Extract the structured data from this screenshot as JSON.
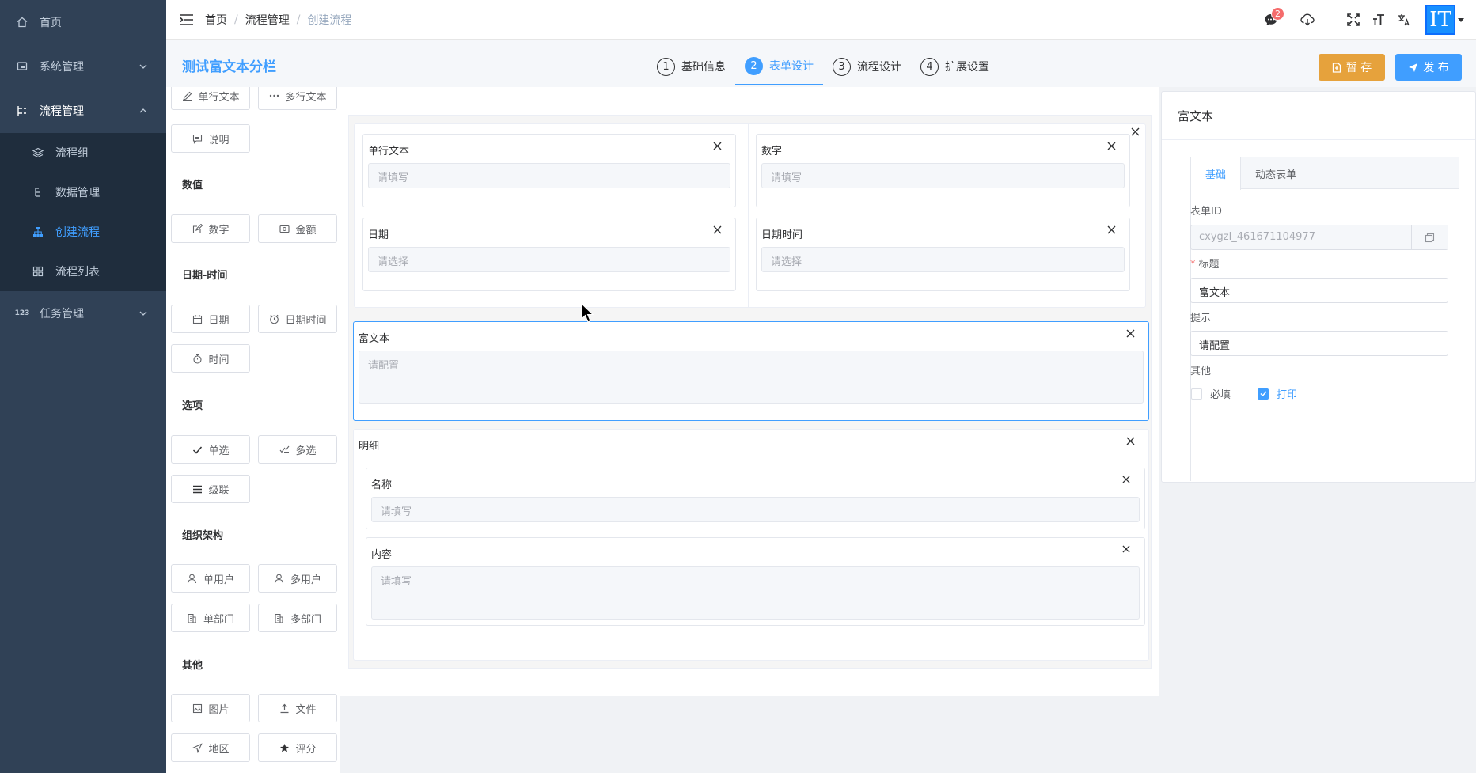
{
  "sidebar": {
    "items": [
      {
        "label": "首页",
        "icon": "home-icon"
      },
      {
        "label": "系统管理",
        "icon": "monitor-icon"
      },
      {
        "label": "流程管理",
        "icon": "tree-icon"
      },
      {
        "label": "任务管理",
        "icon": "number-icon"
      }
    ],
    "flow_children": [
      {
        "label": "流程组",
        "icon": "layers-icon"
      },
      {
        "label": "数据管理",
        "icon": "tree-small-icon"
      },
      {
        "label": "创建流程",
        "icon": "org-chart-icon",
        "active": true
      },
      {
        "label": "流程列表",
        "icon": "grid-icon"
      }
    ]
  },
  "navbar": {
    "breadcrumb": [
      "首页",
      "流程管理",
      "创建流程"
    ],
    "badge_count": "2",
    "avatar_text": "IT"
  },
  "header": {
    "form_title": "测试富文本分栏",
    "steps": [
      {
        "num": "1",
        "label": "基础信息"
      },
      {
        "num": "2",
        "label": "表单设计"
      },
      {
        "num": "3",
        "label": "流程设计"
      },
      {
        "num": "4",
        "label": "扩展设置"
      }
    ],
    "save_label": "暂 存",
    "publish_label": "发 布"
  },
  "palette": {
    "categories": [
      "数值",
      "日期-时间",
      "选项",
      "组织架构",
      "其他"
    ],
    "buttons": {
      "single_text": "单行文本",
      "multi_text": "多行文本",
      "description": "说明",
      "number": "数字",
      "amount": "金额",
      "date": "日期",
      "datetime": "日期时间",
      "time": "时间",
      "radio": "单选",
      "checkbox": "多选",
      "cascade": "级联",
      "single_user": "单用户",
      "multi_user": "多用户",
      "single_dept": "单部门",
      "multi_dept": "多部门",
      "image": "图片",
      "file": "文件",
      "region": "地区",
      "rating": "评分"
    }
  },
  "canvas": {
    "fields": {
      "single_text": {
        "label": "单行文本",
        "placeholder": "请填写"
      },
      "number": {
        "label": "数字",
        "placeholder": "请填写"
      },
      "date": {
        "label": "日期",
        "placeholder": "请选择"
      },
      "datetime": {
        "label": "日期时间",
        "placeholder": "请选择"
      },
      "rich_text": {
        "label": "富文本",
        "placeholder": "请配置"
      },
      "detail": {
        "label": "明细"
      },
      "name": {
        "label": "名称",
        "placeholder": "请填写"
      },
      "content": {
        "label": "内容",
        "placeholder": "请填写"
      }
    }
  },
  "props": {
    "title": "富文本",
    "tabs": [
      "基础",
      "动态表单"
    ],
    "form_id_label": "表单ID",
    "form_id_value": "cxygzl_461671104977",
    "title_label": "标题",
    "title_value": "富文本",
    "hint_label": "提示",
    "hint_value": "请配置",
    "other_label": "其他",
    "required_label": "必填",
    "print_label": "打印",
    "required_checked": false,
    "print_checked": true
  },
  "colors": {
    "sidebar_bg": "#304156",
    "primary": "#409eff",
    "warning": "#e6a23c"
  }
}
